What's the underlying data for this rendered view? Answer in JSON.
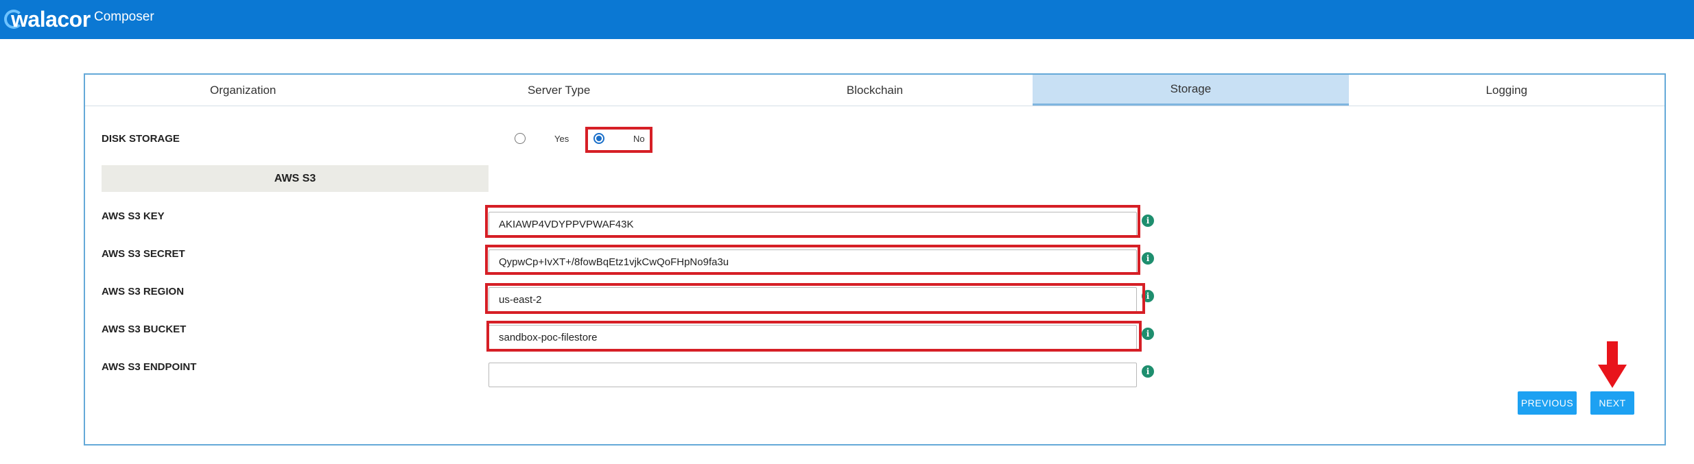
{
  "header": {
    "logo_text": "walacor",
    "app_name": "Composer"
  },
  "tabs": [
    {
      "label": "Organization"
    },
    {
      "label": "Server Type"
    },
    {
      "label": "Blockchain"
    },
    {
      "label": "Storage",
      "active": true
    },
    {
      "label": "Logging"
    }
  ],
  "disk_storage": {
    "label": "DISK STORAGE",
    "options": [
      {
        "label": "Yes",
        "selected": false
      },
      {
        "label": "No",
        "selected": true
      }
    ]
  },
  "aws_section": {
    "title": "AWS S3",
    "fields": [
      {
        "label": "AWS S3 KEY",
        "value": "AKIAWP4VDYPPVPWAF43K"
      },
      {
        "label": "AWS S3 SECRET",
        "value": "QypwCp+IvXT+/8fowBqEtz1vjkCwQoFHpNo9fa3u"
      },
      {
        "label": "AWS S3 REGION",
        "value": "us-east-2"
      },
      {
        "label": "AWS S3 BUCKET",
        "value": "sandbox-poc-filestore"
      },
      {
        "label": "AWS S3 ENDPOINT",
        "value": ""
      }
    ]
  },
  "buttons": {
    "previous": "PREVIOUS",
    "next": "NEXT"
  },
  "icons": {
    "info": "i"
  },
  "colors": {
    "header": "#0b78d3",
    "button": "#1da1f2",
    "highlight": "#d61f26",
    "info": "#1e8e6e"
  }
}
